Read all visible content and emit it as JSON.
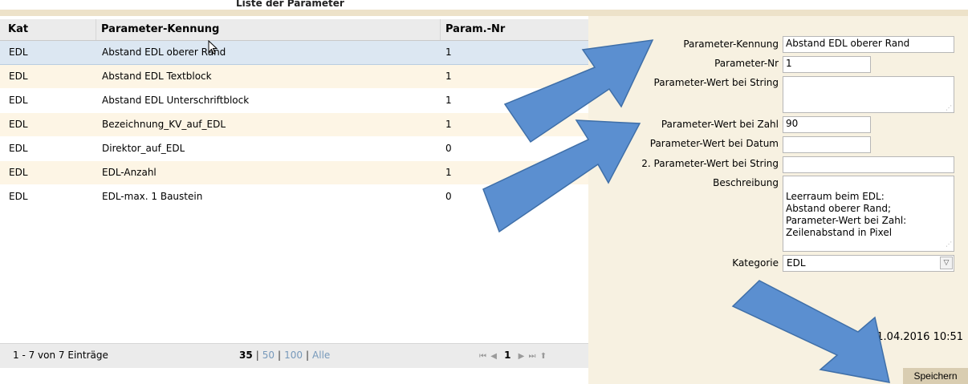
{
  "header": {
    "title": "Liste der Parameter"
  },
  "grid": {
    "columns": [
      "Kat",
      "Parameter-Kennung",
      "Param.-Nr"
    ],
    "rows": [
      {
        "kat": "EDL",
        "kennung": "Abstand EDL oberer Rand",
        "nr": "1"
      },
      {
        "kat": "EDL",
        "kennung": "Abstand EDL Textblock",
        "nr": "1"
      },
      {
        "kat": "EDL",
        "kennung": "Abstand EDL Unterschriftblock",
        "nr": "1"
      },
      {
        "kat": "EDL",
        "kennung": "Bezeichnung_KV_auf_EDL",
        "nr": "1"
      },
      {
        "kat": "EDL",
        "kennung": "Direktor_auf_EDL",
        "nr": "0"
      },
      {
        "kat": "EDL",
        "kennung": "EDL-Anzahl",
        "nr": "1"
      },
      {
        "kat": "EDL",
        "kennung": "EDL-max. 1 Baustein",
        "nr": "0"
      }
    ],
    "selected_row": 0
  },
  "pager": {
    "info": "1 - 7 von 7 Einträge",
    "size_35": "35",
    "size_50": "50",
    "size_100": "100",
    "size_all": "Alle",
    "sep": "|",
    "first": "⏮",
    "prev": "◀",
    "page": "1",
    "next": "▶",
    "last": "⏭",
    "up": "⬆"
  },
  "form": {
    "kennung_label": "Parameter-Kennung",
    "kennung_value": "Abstand EDL oberer Rand",
    "nr_label": "Parameter-Nr",
    "nr_value": "1",
    "wert_string_label": "Parameter-Wert bei String",
    "wert_string_value": "",
    "wert_zahl_label": "Parameter-Wert bei Zahl",
    "wert_zahl_value": "90",
    "wert_datum_label": "Parameter-Wert bei Datum",
    "wert_datum_value": "",
    "wert_string2_label": "2. Parameter-Wert bei String",
    "wert_string2_value": "",
    "beschreibung_label": "Beschreibung",
    "beschreibung_value": "Leerraum beim EDL:\nAbstand oberer Rand;\nParameter-Wert bei Zahl:\nZeilenabstand in Pixel",
    "kategorie_label": "Kategorie",
    "kategorie_value": "EDL",
    "timestamp": "11.04.2016 10:51",
    "save_label": "Speichern"
  },
  "colors": {
    "arrow_fill": "#5b8fd0",
    "arrow_stroke": "#3f6fa8",
    "panel_bg": "#f7f1e1",
    "selected_row": "#dce7f2"
  }
}
